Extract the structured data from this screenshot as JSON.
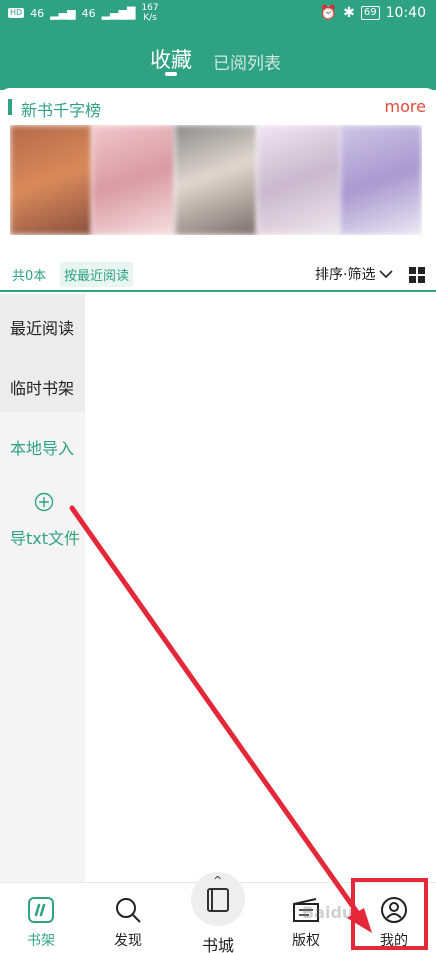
{
  "status": {
    "network": "46",
    "speed_value": "167",
    "speed_unit": "K/s",
    "battery": "69",
    "time": "10:40"
  },
  "header": {
    "active_tab": "收藏",
    "inactive_tab": "已阅列表"
  },
  "ranking": {
    "title": "新书千字榜",
    "more": "more"
  },
  "filter": {
    "count": "共0本",
    "sort_mode": "按最近阅读",
    "sort_filter": "排序·筛选"
  },
  "sidebar": {
    "recent": "最近阅读",
    "temp_shelf": "临时书架",
    "local_import": "本地导入",
    "txt_import": "导txt文件"
  },
  "bottom_nav": {
    "shelf": "书架",
    "discover": "发现",
    "store": "书城",
    "copyright": "版权",
    "mine": "我的"
  },
  "annotation": {
    "color": "#e4283a"
  },
  "watermark": "Baidu"
}
